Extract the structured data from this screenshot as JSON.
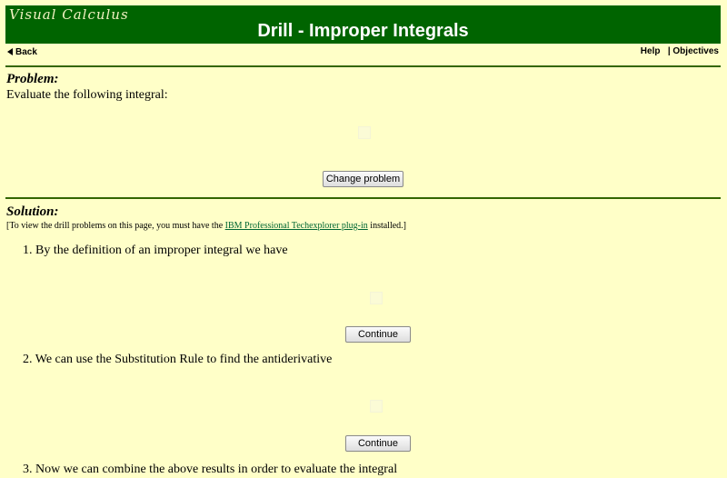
{
  "header": {
    "logo_text": "Visual Calculus",
    "title": "Drill - Improper Integrals"
  },
  "nav": {
    "back_label": "Back",
    "help_label": "Help",
    "separator": "|",
    "objectives_label": "Objectives"
  },
  "problem": {
    "heading": "Problem:",
    "instruction": "Evaluate the following integral:",
    "change_button": "Change problem"
  },
  "solution": {
    "heading": "Solution:",
    "note_prefix": "[To view the drill problems on this page, you must have the ",
    "note_link": "IBM Professional Techexplorer plug-in",
    "note_suffix": " installed.]",
    "steps": [
      {
        "text": "1. By the definition of an improper integral we have",
        "button": "Continue"
      },
      {
        "text": "2. We can use the Substitution Rule to find the antiderivative",
        "button": "Continue"
      },
      {
        "text": "3. Now we can combine the above results in order to evaluate the integral"
      }
    ]
  },
  "colors": {
    "background": "#ffffc8",
    "banner": "#006400",
    "rule": "#336600",
    "link": "#006633"
  }
}
